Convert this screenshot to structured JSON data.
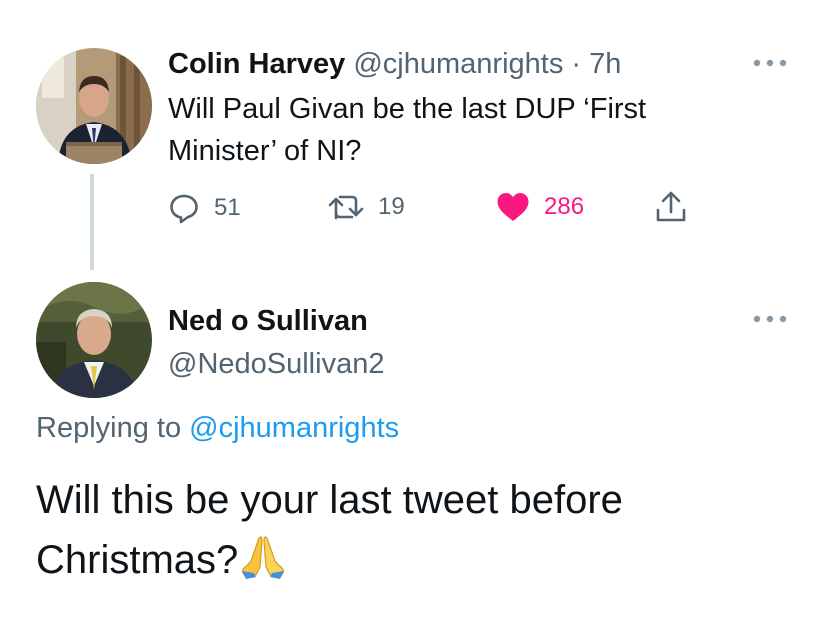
{
  "original_tweet": {
    "display_name": "Colin Harvey",
    "handle": "@cjhumanrights",
    "separator": "·",
    "time": "7h",
    "text": "Will Paul Givan be the last DUP ‘First Minister’ of NI?",
    "more_icon": "more-horizontal-icon",
    "actions": {
      "replies": "51",
      "retweets": "19",
      "likes": "286",
      "reply_icon": "reply-bubble-icon",
      "retweet_icon": "retweet-icon",
      "like_icon": "heart-icon",
      "share_icon": "share-icon"
    },
    "colors": {
      "like": "#f91880",
      "muted": "#536471"
    }
  },
  "reply_tweet": {
    "display_name": "Ned o Sullivan",
    "handle": "@NedoSullivan2",
    "replying_prefix": "Replying to",
    "replying_handle": "@cjhumanrights",
    "text": "Will this be your last tweet before Christmas?",
    "emoji_icon": "folded-hands-emoji-icon",
    "more_icon": "more-horizontal-icon"
  },
  "colors": {
    "link": "#1d9bf0",
    "text": "#0f1419",
    "thread_line": "#cfd9de"
  }
}
